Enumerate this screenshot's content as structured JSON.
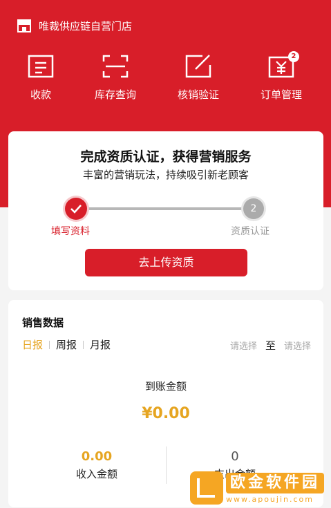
{
  "shop": {
    "name": "唯裁供应链自营门店"
  },
  "quick_actions": [
    {
      "label": "收款"
    },
    {
      "label": "库存查询"
    },
    {
      "label": "核销验证"
    },
    {
      "label": "订单管理",
      "badge": "2"
    }
  ],
  "cert": {
    "title": "完成资质认证，获得营销服务",
    "subtitle": "丰富的营销玩法，持续吸引新老顾客",
    "step1_label": "填写资料",
    "step2_number": "2",
    "step2_label": "资质认证",
    "upload_button": "去上传资质"
  },
  "sales": {
    "title": "销售数据",
    "tabs": [
      "日报",
      "周报",
      "月报"
    ],
    "active_tab": "日报",
    "range_start_placeholder": "请选择",
    "range_to": "至",
    "range_end_placeholder": "请选择",
    "arrival_label": "到账金额",
    "arrival_value": "¥0.00",
    "income_value": "0.00",
    "income_label": "收入金额",
    "expense_value": "0",
    "expense_label": "支出金额"
  },
  "watermark": {
    "title": "欧金软件园",
    "url": "www.apoujin.com"
  },
  "colors": {
    "brand_red": "#d81e29",
    "accent_gold": "#e6a521"
  }
}
